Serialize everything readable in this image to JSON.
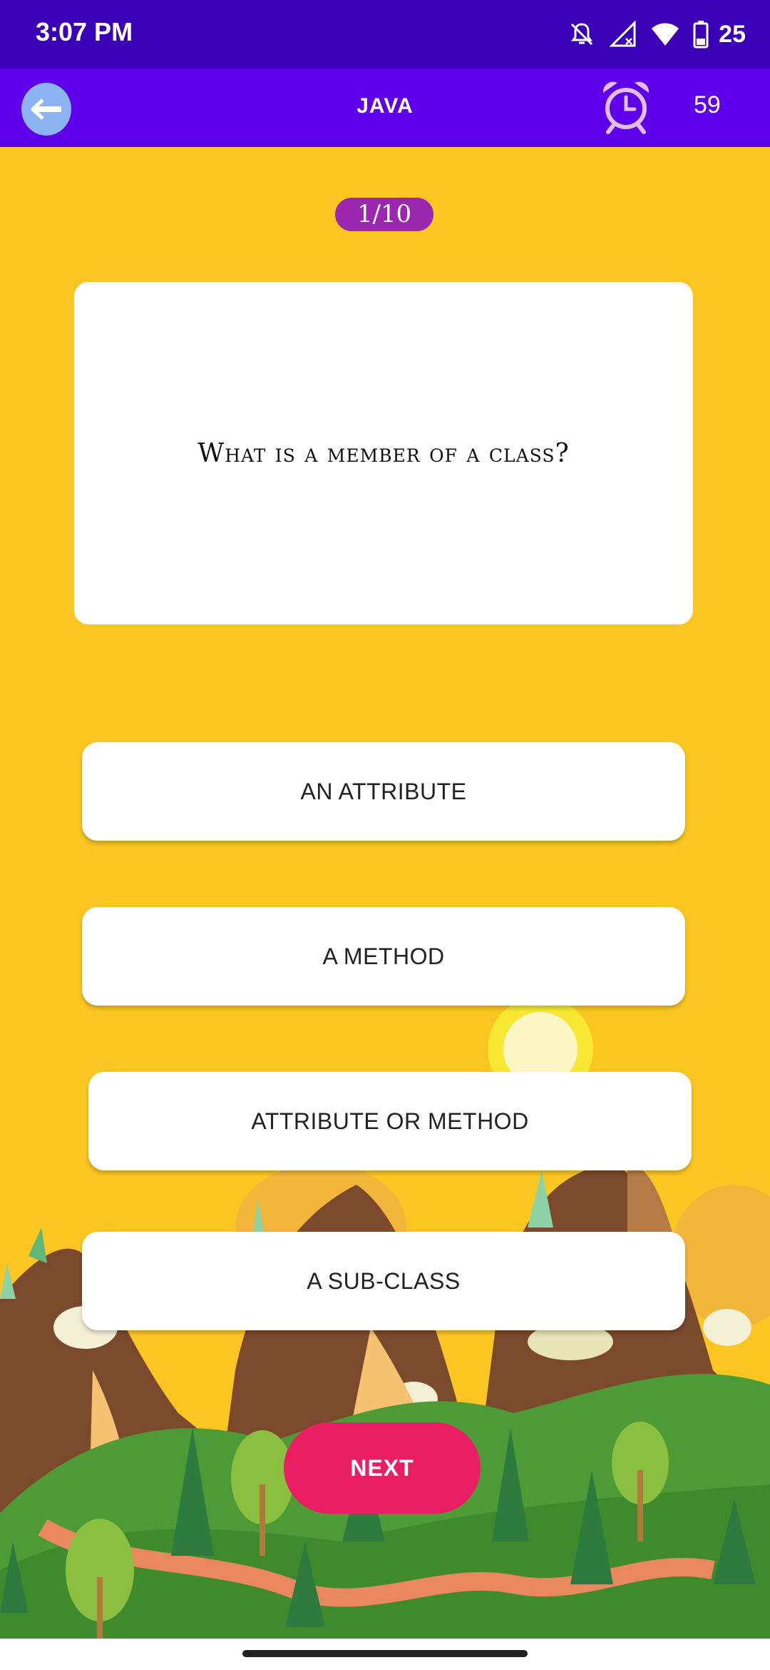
{
  "status_bar": {
    "time": "3:07 PM",
    "battery": "25",
    "icons": [
      "notifications-off-icon",
      "signal-icon",
      "wifi-icon",
      "battery-icon"
    ]
  },
  "app_bar": {
    "title": "JAVA",
    "timer": "59",
    "icons": [
      "back-arrow-icon",
      "alarm-clock-icon"
    ]
  },
  "quiz": {
    "progress": "1/10",
    "question": "What is a member of a class?",
    "options": [
      "AN ATTRIBUTE",
      "A METHOD",
      "ATTRIBUTE OR METHOD",
      "A SUB-CLASS"
    ],
    "next_label": "NEXT"
  },
  "colors": {
    "status_bar": "#3A00B5",
    "app_bar": "#5E00EA",
    "background": "#FCC622",
    "progress_pill": "#9B27B0",
    "next_button": "#E91E63"
  }
}
